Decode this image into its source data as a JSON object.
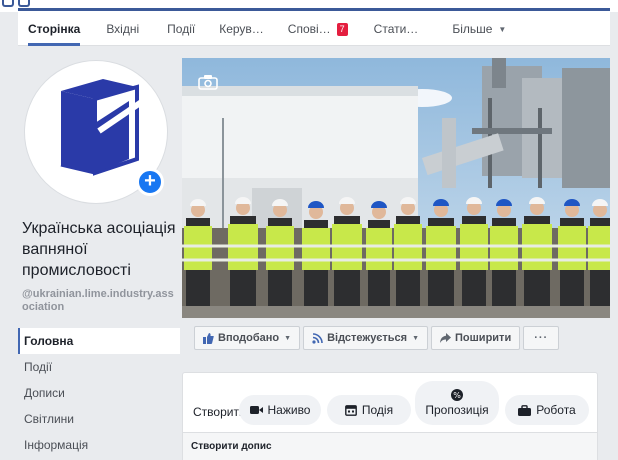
{
  "tabs": [
    {
      "label": "Сторінка",
      "active": true
    },
    {
      "label": "Вхідні"
    },
    {
      "label": "Події"
    },
    {
      "label": "Керув…"
    },
    {
      "label": "Спові…",
      "badge": "7"
    },
    {
      "label": "Стати…"
    },
    {
      "label": "Більше",
      "dropdown": true
    }
  ],
  "profile": {
    "name": "Українська асоціація вапняної промисловості",
    "handle": "@ukrainian.lime.industry.association",
    "logo_color": "#2a3aa8",
    "add_icon": "plus-icon"
  },
  "nav": [
    {
      "label": "Головна",
      "active": true
    },
    {
      "label": "Події"
    },
    {
      "label": "Дописи"
    },
    {
      "label": "Світлини"
    },
    {
      "label": "Інформація"
    }
  ],
  "cover": {
    "camera_icon": "camera-icon"
  },
  "actions": [
    {
      "label": "Вподобано",
      "icon": "thumbs-up-icon",
      "dropdown": true
    },
    {
      "label": "Відстежується",
      "icon": "rss-icon",
      "dropdown": true
    },
    {
      "label": "Поширити",
      "icon": "share-icon"
    },
    {
      "label": "···",
      "icon": "more-icon"
    }
  ],
  "create": {
    "label": "Створити",
    "buttons": [
      {
        "label": "Наживо",
        "icon": "video-icon"
      },
      {
        "label": "Подія",
        "icon": "calendar-icon"
      },
      {
        "label": "Пропозиція",
        "icon": "offer-icon"
      },
      {
        "label": "Робота",
        "icon": "briefcase-icon"
      }
    ],
    "post_label": "Створити допис"
  },
  "colors": {
    "accent": "#4267b2",
    "badge": "#e41e3f",
    "plus": "#1877f2"
  }
}
